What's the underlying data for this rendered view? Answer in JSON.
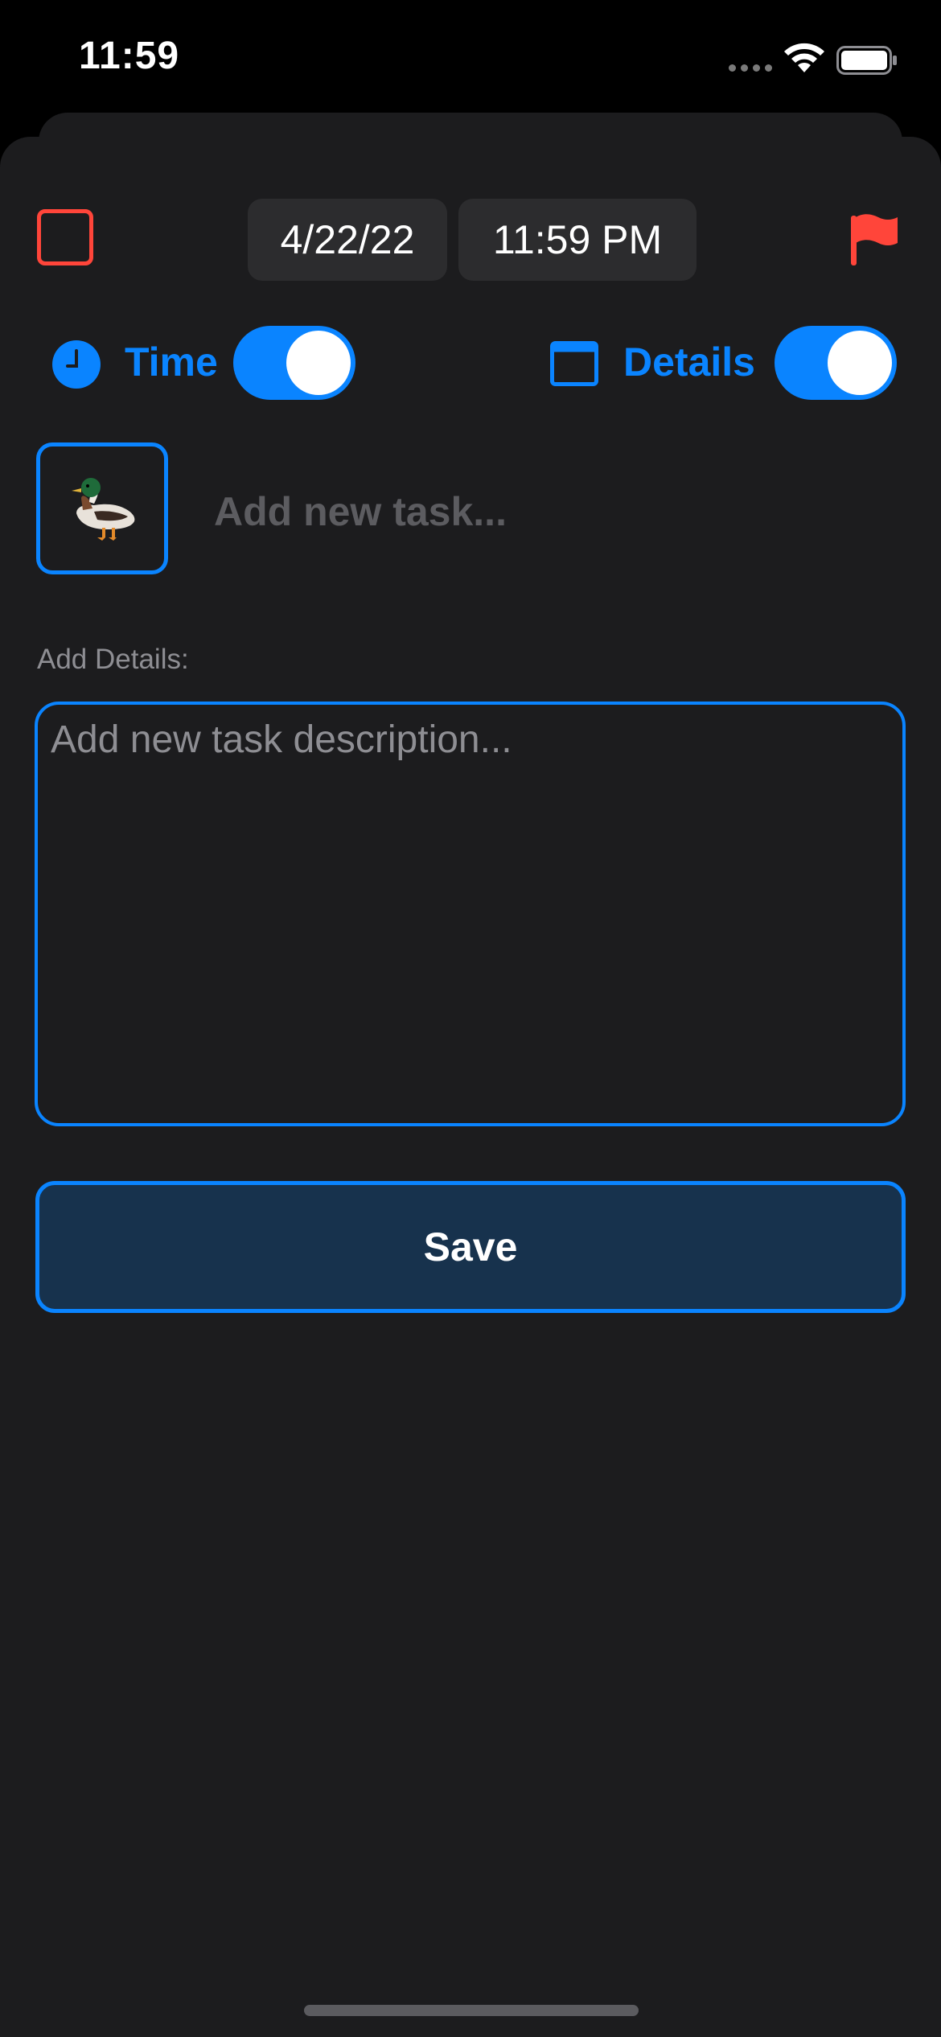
{
  "status_bar": {
    "time": "11:59"
  },
  "task": {
    "date": "4/22/22",
    "time": "11:59 PM",
    "icon": "duck-emoji",
    "name_placeholder": "Add new task...",
    "name_value": ""
  },
  "toggles": {
    "time_label": "Time",
    "time_on": true,
    "details_label": "Details",
    "details_on": true
  },
  "details": {
    "heading": "Add Details:",
    "description_placeholder": "Add new task description...",
    "description_value": ""
  },
  "actions": {
    "save_label": "Save"
  },
  "colors": {
    "accent": "#0a84ff",
    "flag": "#ff453a",
    "background": "#1c1c1e",
    "chip": "#2c2c2e",
    "save_fill": "#17324d"
  }
}
